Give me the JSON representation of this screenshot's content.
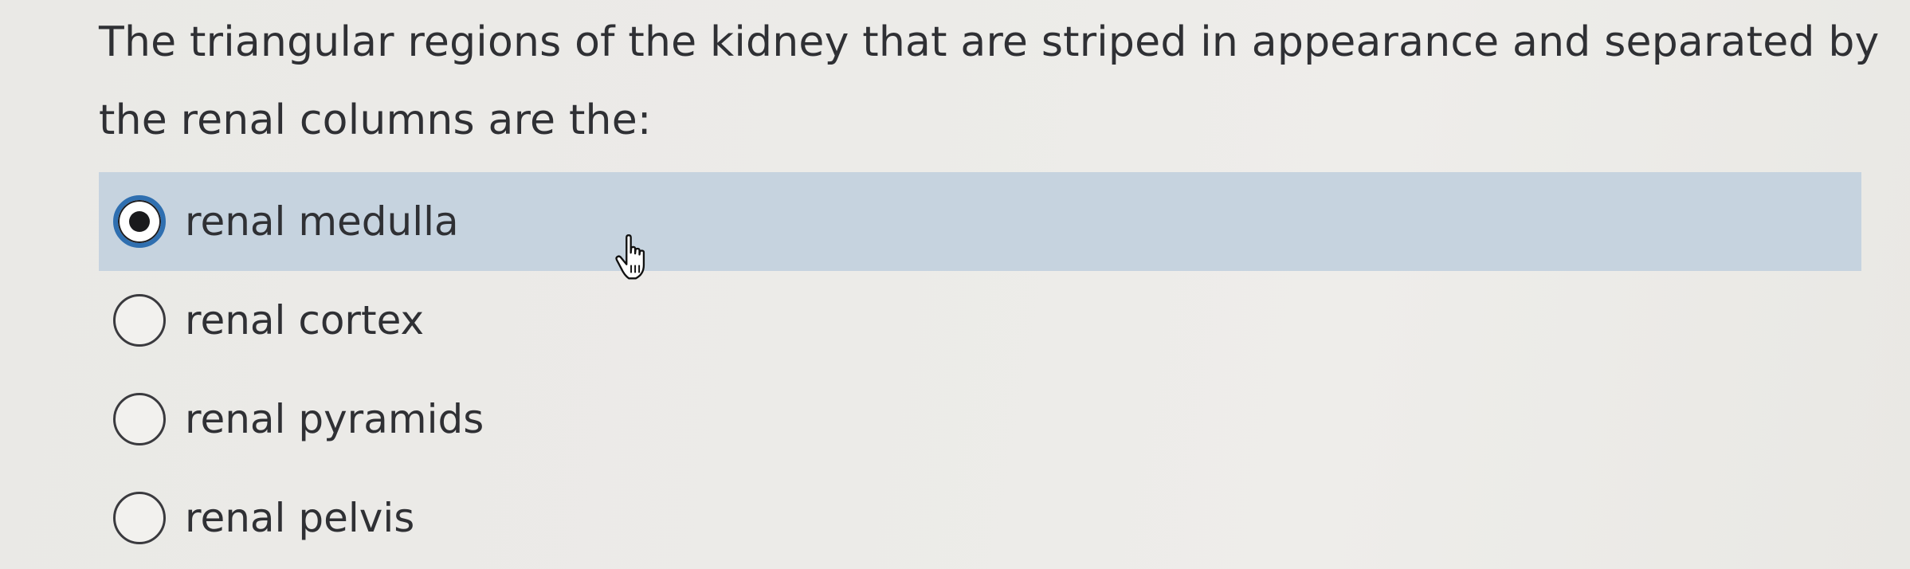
{
  "question": {
    "text": "The triangular regions of the kidney that are striped in appearance and separated by the renal columns are the:"
  },
  "options": [
    {
      "label": "renal medulla",
      "selected": true
    },
    {
      "label": "renal cortex",
      "selected": false
    },
    {
      "label": "renal pyramids",
      "selected": false
    },
    {
      "label": "renal pelvis",
      "selected": false
    }
  ],
  "colors": {
    "selected_highlight": "#c6d3df",
    "radio_selected_ring": "#2f6fb0",
    "text": "#2f3034"
  },
  "cursor": {
    "icon": "hand-pointer-icon"
  }
}
